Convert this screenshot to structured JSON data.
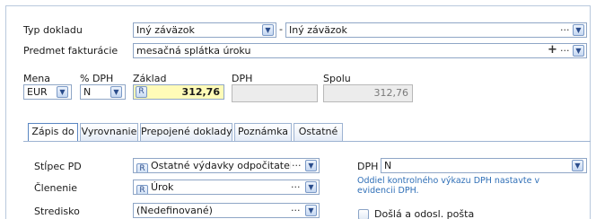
{
  "header": {
    "typ_dokladu": {
      "label": "Typ dokladu",
      "code": "Iný záväzok",
      "value": "Iný záväzok"
    },
    "predmet": {
      "label": "Predmet fakturácie",
      "value": "mesačná splátka úroku"
    }
  },
  "amounts": {
    "mena": {
      "label": "Mena",
      "value": "EUR"
    },
    "dph_pct": {
      "label": "% DPH",
      "value": "N"
    },
    "zaklad": {
      "label": "Základ",
      "badge": "R",
      "value": "312,76"
    },
    "dph": {
      "label": "DPH",
      "value": ""
    },
    "spolu": {
      "label": "Spolu",
      "value": "312,76"
    }
  },
  "tabs": [
    {
      "label": "Zápis do",
      "active": true
    },
    {
      "label": "Vyrovnanie"
    },
    {
      "label": "Prepojené doklady"
    },
    {
      "label": "Poznámka"
    },
    {
      "label": "Ostatné"
    }
  ],
  "zapis": {
    "stlpec_pd": {
      "label": "Stĺpec PD",
      "badge": "R",
      "value": "Ostatné výdavky odpočitateľn"
    },
    "clenenie": {
      "label": "Členenie",
      "badge": "R",
      "value": "Úrok"
    },
    "stredisko": {
      "label": "Stredisko",
      "value": "(Nedefinované)"
    },
    "dph": {
      "label": "DPH",
      "value": "N"
    },
    "hint": "Oddiel kontrolného výkazu DPH nastavte v evidencii DPH.",
    "dosla_label": "Došlá a odosl. pošta"
  },
  "icons": {
    "dropdown": "chevron-down-icon",
    "more": "ellipsis-icon",
    "add": "plus-icon"
  }
}
